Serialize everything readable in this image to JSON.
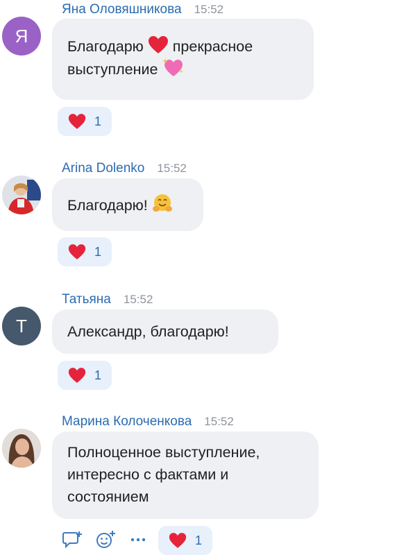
{
  "messages": [
    {
      "author": "Яна Оловяшникова",
      "time": "15:52",
      "avatar_letter": "Я",
      "avatar_color": "#9a62c7",
      "text_part1": "Благодарю",
      "text_part2": " прекрасное выступление",
      "reaction_count": "1"
    },
    {
      "author": "Arina Dolenko",
      "time": "15:52",
      "text": "Благодарю!",
      "reaction_count": "1"
    },
    {
      "author": "Татьяна",
      "time": "15:52",
      "avatar_letter": "Т",
      "avatar_color": "#46586b",
      "text": "Александр, благодарю!",
      "reaction_count": "1"
    },
    {
      "author": "Марина Колоченкова",
      "time": "15:52",
      "text": "Полноценное выступление, интересно с фактами и состоянием",
      "reaction_count": "1"
    }
  ],
  "toolbar": {
    "icons": [
      "reply-icon",
      "add-reaction-icon",
      "more-icon"
    ]
  },
  "colors": {
    "accent": "#2b6bb0",
    "bubble": "#eef0f3",
    "reaction_bg": "#e7f0fb",
    "heart": "#e5243b"
  }
}
